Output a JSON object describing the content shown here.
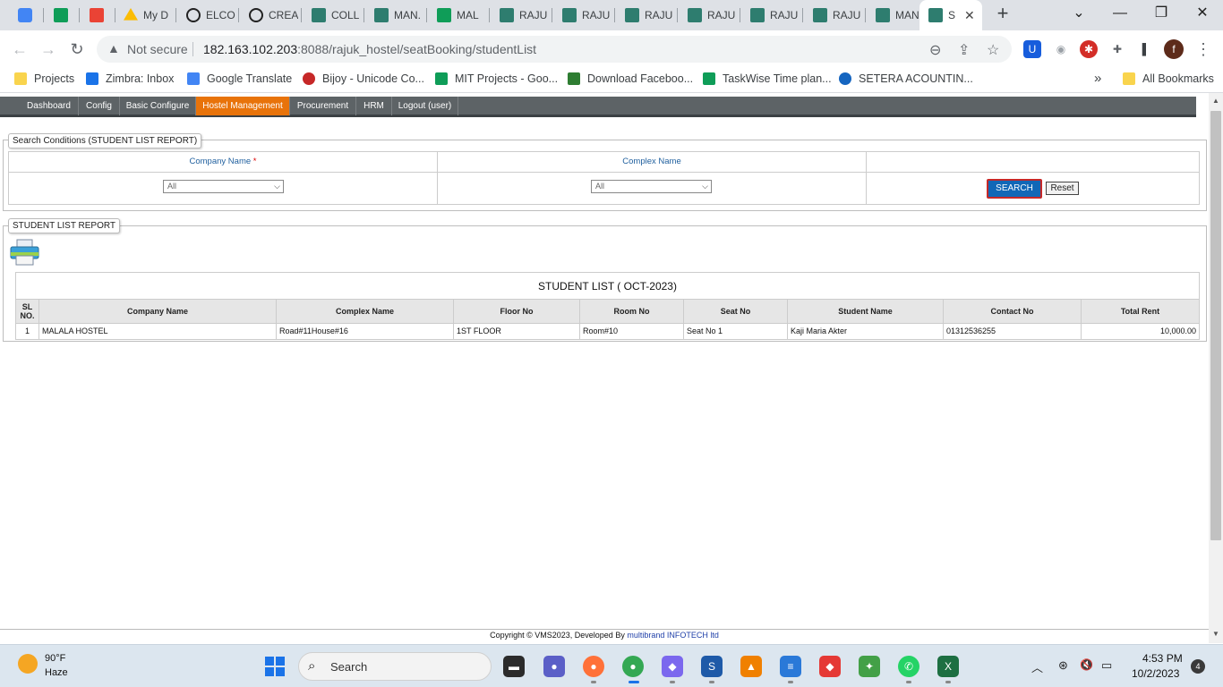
{
  "browser": {
    "tabs": [
      {
        "title": "",
        "icon_color": "#4285f4"
      },
      {
        "title": "",
        "icon_color": "#0f9d58"
      },
      {
        "title": "",
        "icon_color": "#ea4335"
      },
      {
        "title": "My D",
        "icon_color": "#fbbc04"
      },
      {
        "title": "ELCO",
        "icon_color": "#222222"
      },
      {
        "title": "CREA",
        "icon_color": "#222222"
      },
      {
        "title": "COLL",
        "icon_color": "#2e7d6f"
      },
      {
        "title": "MAN.",
        "icon_color": "#2e7d6f"
      },
      {
        "title": "MAL",
        "icon_color": "#0f9d58"
      },
      {
        "title": "RAJU",
        "icon_color": "#2e7d6f"
      },
      {
        "title": "RAJU",
        "icon_color": "#2e7d6f"
      },
      {
        "title": "RAJU",
        "icon_color": "#2e7d6f"
      },
      {
        "title": "RAJU",
        "icon_color": "#2e7d6f"
      },
      {
        "title": "RAJU",
        "icon_color": "#2e7d6f"
      },
      {
        "title": "RAJU",
        "icon_color": "#2e7d6f"
      },
      {
        "title": "MAN.",
        "icon_color": "#2e7d6f"
      },
      {
        "title": "S",
        "icon_color": "#2e7d6f",
        "active": true
      }
    ],
    "new_tab": "+",
    "controls": {
      "dropdown": "⌄",
      "minimize": "—",
      "restore": "❐",
      "close": "✕"
    },
    "nav": {
      "back": "←",
      "forward": "→",
      "reload": "↻"
    },
    "omnibox": {
      "warning_icon": "▲",
      "security_label": "Not secure",
      "host": "182.163.102.203",
      "path": ":8088/rajuk_hostel/seatBooking/studentList"
    },
    "omnibox_icons": {
      "zoom": "⊖",
      "share": "⇪",
      "bookmark": "☆"
    },
    "extensions": [
      {
        "name": "bitwarden",
        "glyph": "U",
        "color": "#175ddc"
      },
      {
        "name": "camera",
        "glyph": "◉",
        "color": "#9aa0a6"
      },
      {
        "name": "lastpass",
        "glyph": "✱",
        "color": "#d32d27"
      },
      {
        "name": "puzzle",
        "glyph": "✚",
        "color": "#5f6368"
      },
      {
        "name": "sidepanel",
        "glyph": "▌",
        "color": "#3c4043"
      }
    ],
    "profile_initial": "f",
    "menu": "⋮",
    "bookmarks": [
      {
        "label": "Projects",
        "icon_color": "#f9d44d"
      },
      {
        "label": "Zimbra: Inbox",
        "icon_color": "#1a73e8"
      },
      {
        "label": "Google Translate",
        "icon_color": "#4285f4"
      },
      {
        "label": "Bijoy - Unicode Co...",
        "icon_color": "#c62828"
      },
      {
        "label": "MIT Projects - Goo...",
        "icon_color": "#0f9d58"
      },
      {
        "label": "Download Faceboo...",
        "icon_color": "#2e7d32"
      },
      {
        "label": "TaskWise Time plan...",
        "icon_color": "#0f9d58"
      },
      {
        "label": "SETERA ACOUNTIN...",
        "icon_color": "#1565c0"
      }
    ],
    "bookmarks_more": "»",
    "all_bookmarks": "All Bookmarks"
  },
  "app": {
    "menu": [
      {
        "label": "Dashboard"
      },
      {
        "label": "Config"
      },
      {
        "label": "Basic Configure"
      },
      {
        "label": "Hostel Management",
        "active": true
      },
      {
        "label": "Procurement"
      },
      {
        "label": "HRM"
      },
      {
        "label": "Logout (user)"
      }
    ],
    "search_section": {
      "legend": "Search Conditions (STUDENT LIST REPORT)",
      "company_label": "Company Name",
      "required_mark": "*",
      "complex_label": "Complex Name",
      "company_value": "All",
      "complex_value": "All",
      "search_button": "SEARCH",
      "reset_button": "Reset"
    },
    "report_section": {
      "legend": "STUDENT LIST REPORT",
      "title": "STUDENT LIST ( OCT-2023)",
      "columns": [
        "SL NO.",
        "Company Name",
        "Complex Name",
        "Floor No",
        "Room No",
        "Seat No",
        "Student Name",
        "Contact No",
        "Total Rent"
      ],
      "rows": [
        [
          "1",
          "MALALA HOSTEL",
          "Road#11House#16",
          "1ST FLOOR",
          "Room#10",
          "Seat No 1",
          "Kaji Maria Akter",
          "01312536255",
          "10,000.00"
        ]
      ]
    },
    "footer": {
      "text": "Copyright © VMS2023, Developed By",
      "brand": "multibrand INFOTECH ltd"
    }
  },
  "taskbar": {
    "weather_temp": "90°F",
    "weather_desc": "Haze",
    "search_placeholder": "Search",
    "apps": [
      {
        "name": "file-explorer",
        "color": "#2b2b2b",
        "glyph": "▬"
      },
      {
        "name": "teams",
        "color": "#5b5fc7",
        "glyph": "●"
      },
      {
        "name": "firefox",
        "color": "#ff7139",
        "glyph": "●"
      },
      {
        "name": "chrome",
        "color": "#34a853",
        "glyph": "●"
      },
      {
        "name": "clickup",
        "color": "#7b68ee",
        "glyph": "◆"
      },
      {
        "name": "app-s",
        "color": "#1e5aa8",
        "glyph": "S"
      },
      {
        "name": "vlc",
        "color": "#f08000",
        "glyph": "▲"
      },
      {
        "name": "notepad",
        "color": "#2a79d8",
        "glyph": "≡"
      },
      {
        "name": "anydesk",
        "color": "#e53935",
        "glyph": "◆"
      },
      {
        "name": "app-umbrella",
        "color": "#43a047",
        "glyph": "✦"
      },
      {
        "name": "whatsapp",
        "color": "#25d366",
        "glyph": "✆"
      },
      {
        "name": "excel",
        "color": "#1d6f42",
        "glyph": "X"
      }
    ],
    "tray": {
      "chevron": "︿",
      "wifi": "⊛",
      "volume": "🔇",
      "battery": "▭"
    },
    "time": "4:53 PM",
    "date": "10/2/2023",
    "notifications": "4"
  }
}
